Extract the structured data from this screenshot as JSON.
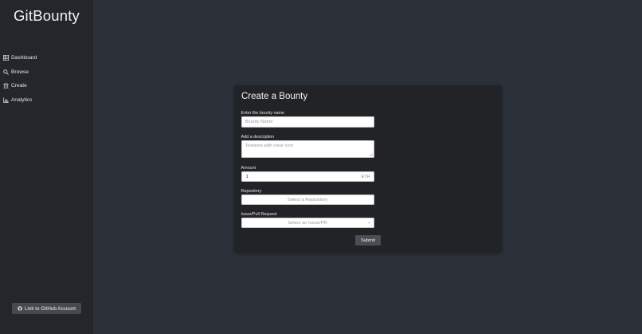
{
  "app": {
    "title": "GitBounty"
  },
  "sidebar": {
    "items": [
      {
        "label": "Dashboard",
        "icon": "grid-icon"
      },
      {
        "label": "Browse",
        "icon": "search-icon"
      },
      {
        "label": "Create",
        "icon": "bank-icon"
      },
      {
        "label": "Analytics",
        "icon": "bar-chart-icon"
      }
    ],
    "github_button": {
      "label": "Link to GitHub Account",
      "icon": "github-icon"
    }
  },
  "form": {
    "title": "Create a Bounty",
    "name": {
      "label": "Enter the bounty name",
      "placeholder": "Bounty Name"
    },
    "description": {
      "label": "Add a description",
      "placeholder": "Textarea with clear icon"
    },
    "amount": {
      "label": "Amount",
      "value": "1",
      "unit": "ETH"
    },
    "repository": {
      "label": "Repository",
      "placeholder": "Select a Repository"
    },
    "issue": {
      "label": "Issue/Pull Request",
      "placeholder": "Select an Issue/PR"
    },
    "submit_label": "Submit"
  },
  "colors": {
    "background": "#2b3039",
    "sidebar": "#23272c",
    "card": "#212327",
    "button": "#4a4e53"
  }
}
